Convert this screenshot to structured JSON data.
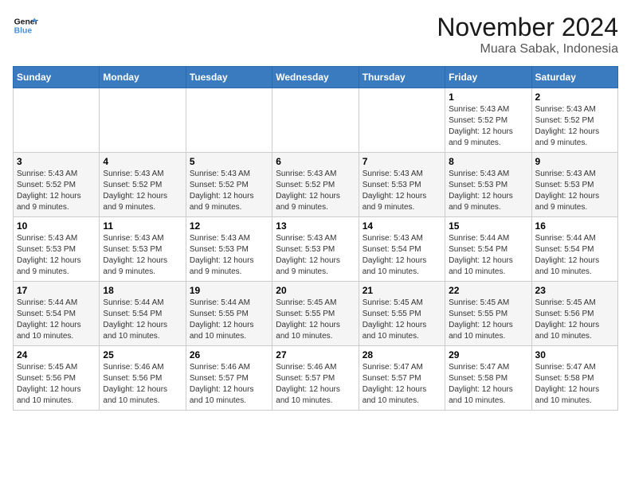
{
  "logo": {
    "line1": "General",
    "line2": "Blue"
  },
  "title": "November 2024",
  "location": "Muara Sabak, Indonesia",
  "days_of_week": [
    "Sunday",
    "Monday",
    "Tuesday",
    "Wednesday",
    "Thursday",
    "Friday",
    "Saturday"
  ],
  "weeks": [
    [
      {
        "day": "",
        "info": ""
      },
      {
        "day": "",
        "info": ""
      },
      {
        "day": "",
        "info": ""
      },
      {
        "day": "",
        "info": ""
      },
      {
        "day": "",
        "info": ""
      },
      {
        "day": "1",
        "info": "Sunrise: 5:43 AM\nSunset: 5:52 PM\nDaylight: 12 hours and 9 minutes."
      },
      {
        "day": "2",
        "info": "Sunrise: 5:43 AM\nSunset: 5:52 PM\nDaylight: 12 hours and 9 minutes."
      }
    ],
    [
      {
        "day": "3",
        "info": "Sunrise: 5:43 AM\nSunset: 5:52 PM\nDaylight: 12 hours and 9 minutes."
      },
      {
        "day": "4",
        "info": "Sunrise: 5:43 AM\nSunset: 5:52 PM\nDaylight: 12 hours and 9 minutes."
      },
      {
        "day": "5",
        "info": "Sunrise: 5:43 AM\nSunset: 5:52 PM\nDaylight: 12 hours and 9 minutes."
      },
      {
        "day": "6",
        "info": "Sunrise: 5:43 AM\nSunset: 5:52 PM\nDaylight: 12 hours and 9 minutes."
      },
      {
        "day": "7",
        "info": "Sunrise: 5:43 AM\nSunset: 5:53 PM\nDaylight: 12 hours and 9 minutes."
      },
      {
        "day": "8",
        "info": "Sunrise: 5:43 AM\nSunset: 5:53 PM\nDaylight: 12 hours and 9 minutes."
      },
      {
        "day": "9",
        "info": "Sunrise: 5:43 AM\nSunset: 5:53 PM\nDaylight: 12 hours and 9 minutes."
      }
    ],
    [
      {
        "day": "10",
        "info": "Sunrise: 5:43 AM\nSunset: 5:53 PM\nDaylight: 12 hours and 9 minutes."
      },
      {
        "day": "11",
        "info": "Sunrise: 5:43 AM\nSunset: 5:53 PM\nDaylight: 12 hours and 9 minutes."
      },
      {
        "day": "12",
        "info": "Sunrise: 5:43 AM\nSunset: 5:53 PM\nDaylight: 12 hours and 9 minutes."
      },
      {
        "day": "13",
        "info": "Sunrise: 5:43 AM\nSunset: 5:53 PM\nDaylight: 12 hours and 9 minutes."
      },
      {
        "day": "14",
        "info": "Sunrise: 5:43 AM\nSunset: 5:54 PM\nDaylight: 12 hours and 10 minutes."
      },
      {
        "day": "15",
        "info": "Sunrise: 5:44 AM\nSunset: 5:54 PM\nDaylight: 12 hours and 10 minutes."
      },
      {
        "day": "16",
        "info": "Sunrise: 5:44 AM\nSunset: 5:54 PM\nDaylight: 12 hours and 10 minutes."
      }
    ],
    [
      {
        "day": "17",
        "info": "Sunrise: 5:44 AM\nSunset: 5:54 PM\nDaylight: 12 hours and 10 minutes."
      },
      {
        "day": "18",
        "info": "Sunrise: 5:44 AM\nSunset: 5:54 PM\nDaylight: 12 hours and 10 minutes."
      },
      {
        "day": "19",
        "info": "Sunrise: 5:44 AM\nSunset: 5:55 PM\nDaylight: 12 hours and 10 minutes."
      },
      {
        "day": "20",
        "info": "Sunrise: 5:45 AM\nSunset: 5:55 PM\nDaylight: 12 hours and 10 minutes."
      },
      {
        "day": "21",
        "info": "Sunrise: 5:45 AM\nSunset: 5:55 PM\nDaylight: 12 hours and 10 minutes."
      },
      {
        "day": "22",
        "info": "Sunrise: 5:45 AM\nSunset: 5:55 PM\nDaylight: 12 hours and 10 minutes."
      },
      {
        "day": "23",
        "info": "Sunrise: 5:45 AM\nSunset: 5:56 PM\nDaylight: 12 hours and 10 minutes."
      }
    ],
    [
      {
        "day": "24",
        "info": "Sunrise: 5:45 AM\nSunset: 5:56 PM\nDaylight: 12 hours and 10 minutes."
      },
      {
        "day": "25",
        "info": "Sunrise: 5:46 AM\nSunset: 5:56 PM\nDaylight: 12 hours and 10 minutes."
      },
      {
        "day": "26",
        "info": "Sunrise: 5:46 AM\nSunset: 5:57 PM\nDaylight: 12 hours and 10 minutes."
      },
      {
        "day": "27",
        "info": "Sunrise: 5:46 AM\nSunset: 5:57 PM\nDaylight: 12 hours and 10 minutes."
      },
      {
        "day": "28",
        "info": "Sunrise: 5:47 AM\nSunset: 5:57 PM\nDaylight: 12 hours and 10 minutes."
      },
      {
        "day": "29",
        "info": "Sunrise: 5:47 AM\nSunset: 5:58 PM\nDaylight: 12 hours and 10 minutes."
      },
      {
        "day": "30",
        "info": "Sunrise: 5:47 AM\nSunset: 5:58 PM\nDaylight: 12 hours and 10 minutes."
      }
    ]
  ]
}
